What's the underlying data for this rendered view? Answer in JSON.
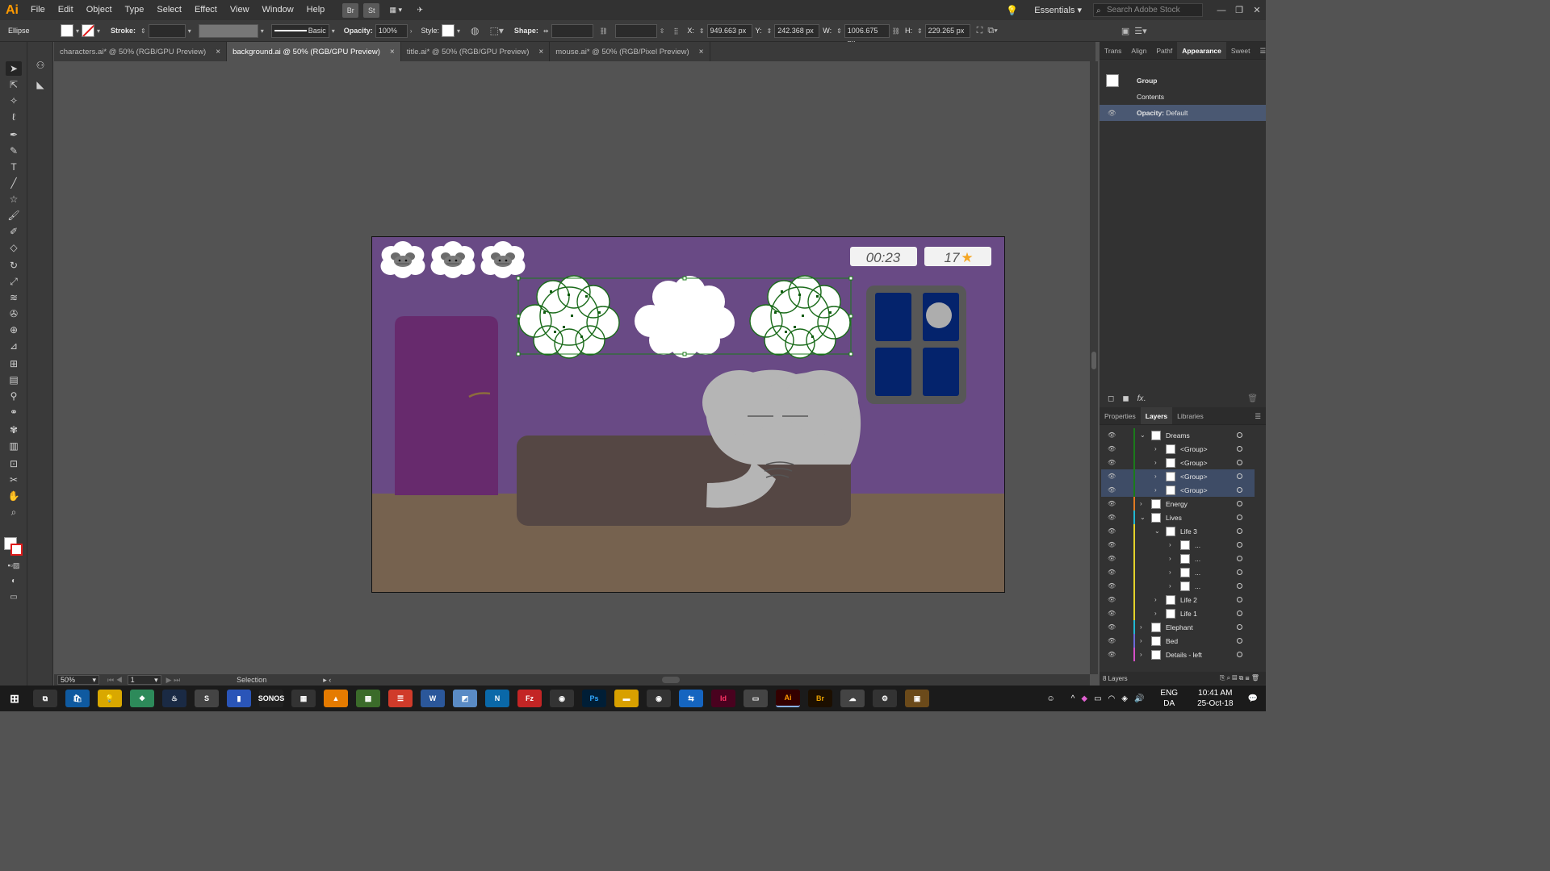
{
  "menubar": {
    "logo": "Ai",
    "items": [
      "File",
      "Edit",
      "Object",
      "Type",
      "Select",
      "Effect",
      "View",
      "Window",
      "Help"
    ],
    "bridge": "Br",
    "stock": "St",
    "workspace": "Essentials",
    "search_placeholder": "Search Adobe Stock"
  },
  "controlbar": {
    "shape_type": "Ellipse",
    "stroke_label": "Stroke:",
    "stroke_style": "Basic",
    "opacity_label": "Opacity:",
    "opacity_value": "100%",
    "style_label": "Style:",
    "shape_label": "Shape:",
    "x_label": "X:",
    "x_value": "949.663 px",
    "y_label": "Y:",
    "y_value": "242.368 px",
    "w_label": "W:",
    "w_value": "1006.675 px",
    "h_label": "H:",
    "h_value": "229.265 px"
  },
  "tabs": [
    {
      "label": "characters.ai* @ 50% (RGB/GPU Preview)",
      "active": false
    },
    {
      "label": "background.ai @ 50% (RGB/GPU Preview)",
      "active": true
    },
    {
      "label": "title.ai* @ 50% (RGB/GPU Preview)",
      "active": false
    },
    {
      "label": "mouse.ai* @ 50% (RGB/Pixel Preview)",
      "active": false
    }
  ],
  "artboard": {
    "timer": "00:23",
    "score": "17",
    "wall_color": "#694a85",
    "floor_color": "#76624f",
    "door_color": "#672a6d",
    "bed_color": "#554744",
    "window_glass": "#04236c",
    "window_frame": "#575757",
    "elephant_color": "#b5b5b5"
  },
  "statusbar": {
    "zoom": "50%",
    "page": "1",
    "tool": "Selection"
  },
  "appearance": {
    "tabs": [
      "Trans",
      "Align",
      "Pathf",
      "Appearance",
      "Sweet"
    ],
    "rows": [
      "Group",
      "Contents",
      "Opacity:",
      "Default"
    ]
  },
  "layers": {
    "tabs": [
      "Properties",
      "Layers",
      "Libraries"
    ],
    "rows": [
      {
        "name": "Dreams",
        "level": 0,
        "color": "#1b7b1b",
        "open": true,
        "sel": false
      },
      {
        "name": "<Group>",
        "level": 1,
        "color": "#1b7b1b",
        "open": false,
        "sel": false
      },
      {
        "name": "<Group>",
        "level": 1,
        "color": "#1b7b1b",
        "open": false,
        "sel": false
      },
      {
        "name": "<Group>",
        "level": 1,
        "color": "#1b7b1b",
        "open": false,
        "sel": true
      },
      {
        "name": "<Group>",
        "level": 1,
        "color": "#1b7b1b",
        "open": false,
        "sel": true
      },
      {
        "name": "Energy",
        "level": 0,
        "color": "#e07a22",
        "open": false,
        "sel": false
      },
      {
        "name": "Lives",
        "level": 0,
        "color": "#21b7d3",
        "open": true,
        "sel": false
      },
      {
        "name": "Life 3",
        "level": 1,
        "color": "#e3d22a",
        "open": true,
        "sel": false
      },
      {
        "name": "...",
        "level": 2,
        "color": "#e3d22a",
        "open": false,
        "sel": false
      },
      {
        "name": "...",
        "level": 2,
        "color": "#e3d22a",
        "open": false,
        "sel": false
      },
      {
        "name": "...",
        "level": 2,
        "color": "#e3d22a",
        "open": false,
        "sel": false
      },
      {
        "name": "...",
        "level": 2,
        "color": "#e3d22a",
        "open": false,
        "sel": false
      },
      {
        "name": "Life 2",
        "level": 1,
        "color": "#e3d22a",
        "open": false,
        "sel": false
      },
      {
        "name": "Life 1",
        "level": 1,
        "color": "#e3d22a",
        "open": false,
        "sel": false
      },
      {
        "name": "Elephant",
        "level": 0,
        "color": "#21b7d3",
        "open": false,
        "sel": false
      },
      {
        "name": "Bed",
        "level": 0,
        "color": "#6a6ad8",
        "open": false,
        "sel": false
      },
      {
        "name": "Details - left",
        "level": 0,
        "color": "#d450c8",
        "open": false,
        "sel": false
      }
    ],
    "count": "8 Layers"
  },
  "taskbar": {
    "lang": "ENG",
    "region": "DA",
    "time": "10:41 AM",
    "date": "25-Oct-18",
    "apps": [
      "Ps",
      "Id",
      "Ai",
      "Br"
    ]
  }
}
